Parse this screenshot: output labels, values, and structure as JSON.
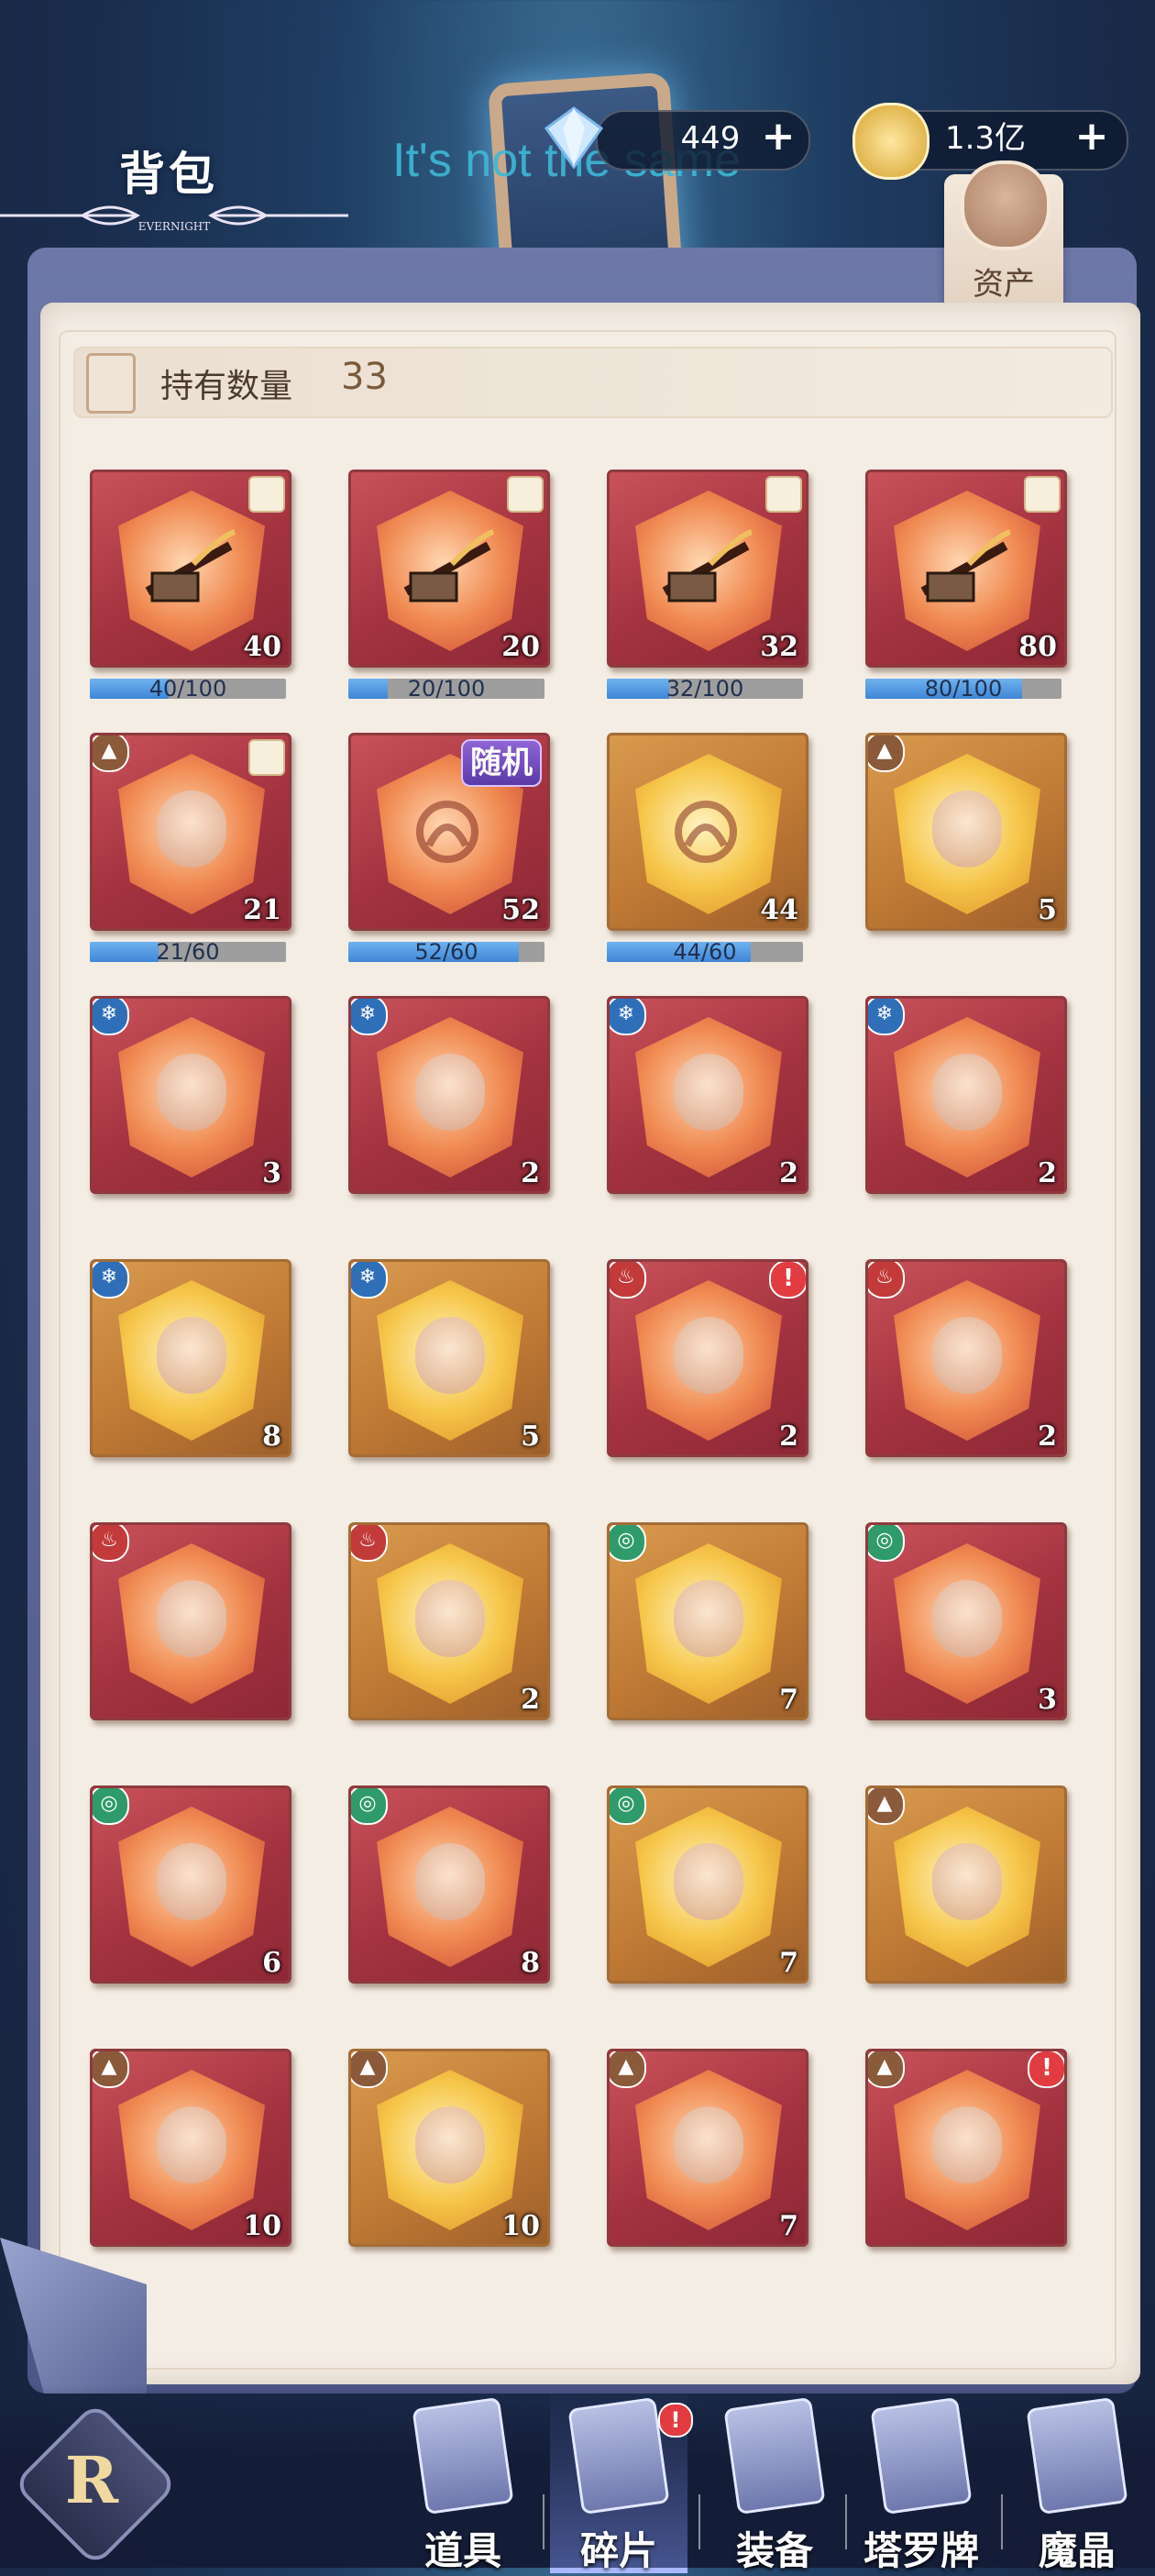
{
  "header": {
    "title": "背包",
    "title_deco": "EVERNIGHT",
    "overlay_text": "It's not the same"
  },
  "currencies": [
    {
      "name": "diamond",
      "icon": "diamond-icon",
      "value": "449",
      "plus": "+"
    },
    {
      "name": "gold",
      "icon": "gold-coin-icon",
      "value": "1.3亿",
      "plus": "+"
    }
  ],
  "asset_tab": {
    "label": "资产",
    "icon": "money-bag-icon"
  },
  "holdings": {
    "label": "持有数量",
    "value": "33"
  },
  "items": [
    {
      "kind": "item",
      "color": "red",
      "icon": "book-icon",
      "qty": "40",
      "puzzle": true,
      "progress": "40/100",
      "fraction": 0.4
    },
    {
      "kind": "item",
      "color": "red",
      "icon": "staff-icon",
      "qty": "20",
      "puzzle": true,
      "progress": "20/100",
      "fraction": 0.2
    },
    {
      "kind": "item",
      "color": "red",
      "icon": "book-icon",
      "qty": "32",
      "puzzle": true,
      "progress": "32/100",
      "fraction": 0.32
    },
    {
      "kind": "item",
      "color": "red",
      "icon": "spear-icon",
      "qty": "80",
      "puzzle": true,
      "progress": "80/100",
      "fraction": 0.8
    },
    {
      "kind": "hero",
      "color": "red",
      "element": "earth",
      "qty": "21",
      "puzzle": true,
      "progress": "21/60",
      "fraction": 0.35
    },
    {
      "kind": "random",
      "color": "red",
      "tag": "随机",
      "qty": "52",
      "progress": "52/60",
      "fraction": 0.867
    },
    {
      "kind": "random",
      "color": "gold",
      "qty": "44",
      "progress": "44/60",
      "fraction": 0.733
    },
    {
      "kind": "hero",
      "color": "gold",
      "element": "earth",
      "qty": "5"
    },
    {
      "kind": "hero",
      "color": "red",
      "element": "ice",
      "qty": "3"
    },
    {
      "kind": "hero",
      "color": "red",
      "element": "ice",
      "qty": "2"
    },
    {
      "kind": "hero",
      "color": "red",
      "element": "ice",
      "qty": "2"
    },
    {
      "kind": "hero",
      "color": "red",
      "element": "ice",
      "qty": "2"
    },
    {
      "kind": "hero",
      "color": "gold",
      "element": "ice",
      "qty": "8"
    },
    {
      "kind": "hero",
      "color": "gold",
      "element": "ice",
      "qty": "5"
    },
    {
      "kind": "hero",
      "color": "red",
      "element": "fire",
      "qty": "2",
      "alert": "!"
    },
    {
      "kind": "hero",
      "color": "red",
      "element": "fire",
      "qty": "2"
    },
    {
      "kind": "hero",
      "color": "red",
      "element": "fire",
      "qty": ""
    },
    {
      "kind": "hero",
      "color": "gold",
      "element": "fire",
      "qty": "2"
    },
    {
      "kind": "hero",
      "color": "gold",
      "element": "wind",
      "qty": "7"
    },
    {
      "kind": "hero",
      "color": "red",
      "element": "wind",
      "qty": "3"
    },
    {
      "kind": "hero",
      "color": "red",
      "element": "wind",
      "qty": "6"
    },
    {
      "kind": "hero",
      "color": "red",
      "element": "wind",
      "qty": "8"
    },
    {
      "kind": "hero",
      "color": "gold",
      "element": "wind",
      "qty": "7"
    },
    {
      "kind": "hero",
      "color": "gold",
      "element": "earth",
      "qty": ""
    },
    {
      "kind": "hero",
      "color": "red",
      "element": "earth",
      "qty": "10"
    },
    {
      "kind": "hero",
      "color": "gold",
      "element": "earth",
      "qty": "10"
    },
    {
      "kind": "hero",
      "color": "red",
      "element": "earth",
      "qty": "7"
    },
    {
      "kind": "hero",
      "color": "red",
      "element": "earth",
      "qty": "",
      "alert": "!"
    }
  ],
  "element_colors": {
    "earth": "#8a5a3a",
    "ice": "#2f6fb8",
    "fire": "#c23a3a",
    "wind": "#2f9a6a"
  },
  "element_glyphs": {
    "earth": "▲",
    "ice": "❄",
    "fire": "♨",
    "wind": "◎"
  },
  "nav": [
    {
      "label": "道具",
      "icon": "items-icon",
      "active": false
    },
    {
      "label": "碎片",
      "icon": "fragments-icon",
      "active": true,
      "alert": "!"
    },
    {
      "label": "装备",
      "icon": "equipment-icon",
      "active": false
    },
    {
      "label": "塔罗牌",
      "icon": "tarot-icon",
      "active": false
    },
    {
      "label": "魔晶",
      "icon": "magic-crystal-icon",
      "active": false
    }
  ],
  "home_glyph": "R"
}
